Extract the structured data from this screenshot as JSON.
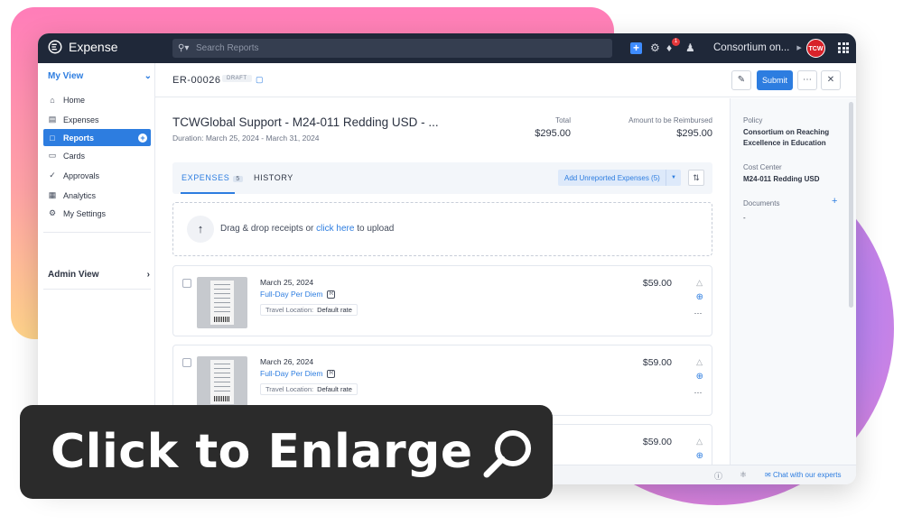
{
  "app": {
    "name": "Expense"
  },
  "topbar": {
    "search_placeholder": "Search Reports",
    "notification_count": "1",
    "org_name": "Consortium on...",
    "avatar_text": "TCW"
  },
  "sidebar": {
    "section_title": "My View",
    "items": [
      {
        "label": "Home",
        "icon": "home-icon"
      },
      {
        "label": "Expenses",
        "icon": "receipt-icon"
      },
      {
        "label": "Reports",
        "icon": "folder-icon"
      },
      {
        "label": "Cards",
        "icon": "card-icon"
      },
      {
        "label": "Approvals",
        "icon": "check-circle-icon"
      },
      {
        "label": "Analytics",
        "icon": "chart-icon"
      },
      {
        "label": "My Settings",
        "icon": "gear-icon"
      }
    ],
    "admin_title": "Admin View"
  },
  "report": {
    "id": "ER-00026",
    "status": "DRAFT",
    "submit_label": "Submit",
    "title": "TCWGlobal Support - M24-011 Redding USD - ...",
    "duration": "Duration: March 25, 2024 - March 31, 2024",
    "total_label": "Total",
    "total_value": "$295.00",
    "reimburse_label": "Amount to be Reimbursed",
    "reimburse_value": "$295.00"
  },
  "tabs": {
    "expenses_label": "EXPENSES",
    "expenses_count": "5",
    "history_label": "HISTORY",
    "add_unreported": "Add Unreported Expenses (5)"
  },
  "dropzone": {
    "text_before": "Drag & drop receipts or ",
    "link": "click here",
    "text_after": " to upload"
  },
  "expenses": [
    {
      "date": "March 25, 2024",
      "category": "Full-Day Per Diem",
      "loc_label": "Travel Location:",
      "loc_value": "Default rate",
      "amount": "$59.00"
    },
    {
      "date": "March 26, 2024",
      "category": "Full-Day Per Diem",
      "loc_label": "Travel Location:",
      "loc_value": "Default rate",
      "amount": "$59.00"
    },
    {
      "date": "",
      "category": "",
      "loc_label": "",
      "loc_value": "",
      "amount": "$59.00"
    }
  ],
  "panel": {
    "policy_label": "Policy",
    "policy_value": "Consortium on Reaching Excellence in Education",
    "cost_center_label": "Cost Center",
    "cost_center_value": "M24-011 Redding USD",
    "documents_label": "Documents",
    "documents_value": "-"
  },
  "footer": {
    "chat_label": "Chat with our experts"
  },
  "cta": {
    "text": "Click to Enlarge"
  },
  "colors": {
    "accent": "#2d7de0",
    "topbar": "#1f2839",
    "cta_bg": "#2b2b2b"
  }
}
